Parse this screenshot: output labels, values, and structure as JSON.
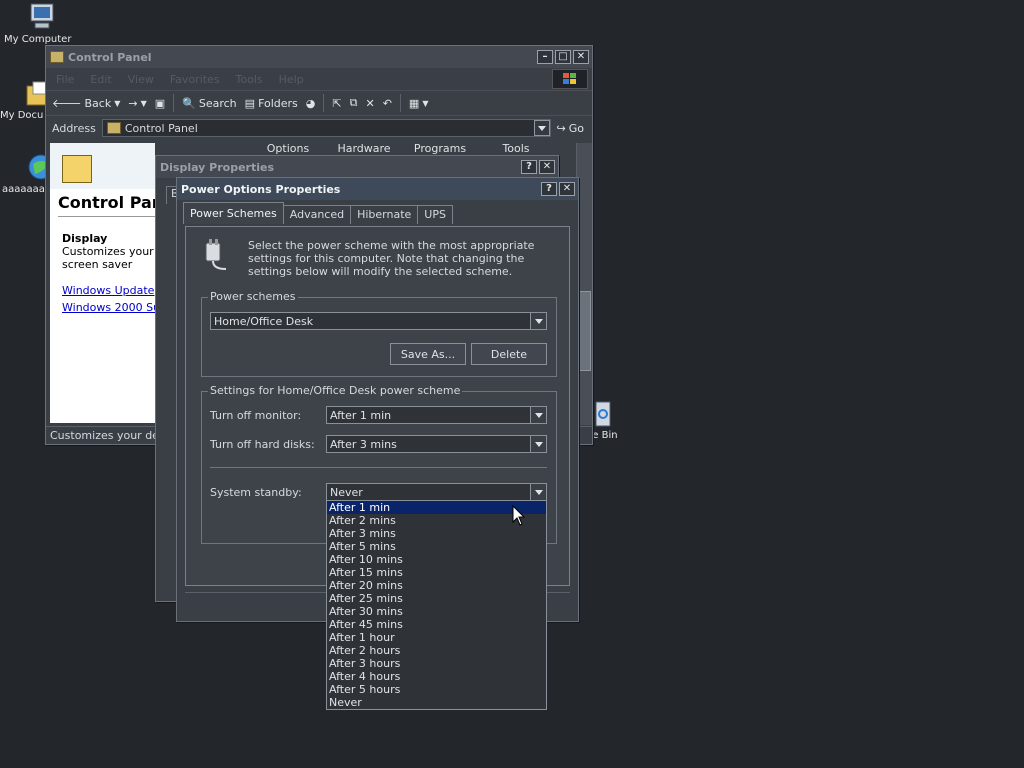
{
  "desktop": {
    "icons": [
      {
        "label": "My Computer",
        "icon": "my-computer-icon"
      },
      {
        "label": "My Documents",
        "icon": "my-documents-icon"
      },
      {
        "label": "aaaaaaa",
        "icon": "internet-explorer-icon"
      },
      {
        "label": "Recycle Bin",
        "icon": "recycle-bin-icon"
      }
    ]
  },
  "control_panel": {
    "title": "Control Panel",
    "menu": [
      "File",
      "Edit",
      "View",
      "Favorites",
      "Tools",
      "Help"
    ],
    "toolbar": {
      "back": "Back",
      "search": "Search",
      "folders": "Folders"
    },
    "address": {
      "label": "Address",
      "value": "Control Panel",
      "go": "Go"
    },
    "columns": [
      "Options",
      "Hardware",
      "Programs",
      "Tools"
    ],
    "content": {
      "heading": "Control Panel",
      "item_title": "Display",
      "item_desc_line1": "Customizes your de",
      "item_desc_line2": "screen saver",
      "link1": "Windows Update",
      "link2": "Windows 2000 Supp"
    },
    "status": "Customizes your desk"
  },
  "display_properties": {
    "title": "Display Properties"
  },
  "power_options": {
    "title": "Power Options Properties",
    "tabs": [
      "Power Schemes",
      "Advanced",
      "Hibernate",
      "UPS"
    ],
    "selected_tab": 0,
    "intro": "Select the power scheme with the most appropriate settings for this computer. Note that changing the settings below will modify the selected scheme.",
    "schemes_group": "Power schemes",
    "scheme_value": "Home/Office Desk",
    "save_as": "Save As...",
    "delete": "Delete",
    "settings_group": "Settings for Home/Office Desk power scheme",
    "monitor_label": "Turn off monitor:",
    "monitor_value": "After 1 min",
    "disks_label": "Turn off hard disks:",
    "disks_value": "After 3 mins",
    "standby_label": "System standby:",
    "standby_value": "Never",
    "standby_options": [
      "After 1 min",
      "After 2 mins",
      "After 3 mins",
      "After 5 mins",
      "After 10 mins",
      "After 15 mins",
      "After 20 mins",
      "After 25 mins",
      "After 30 mins",
      "After 45 mins",
      "After 1 hour",
      "After 2 hours",
      "After 3 hours",
      "After 4 hours",
      "After 5 hours",
      "Never"
    ],
    "highlighted_option": 0
  },
  "colors": {
    "desktop": "#23262b",
    "highlight": "#0a246a"
  }
}
